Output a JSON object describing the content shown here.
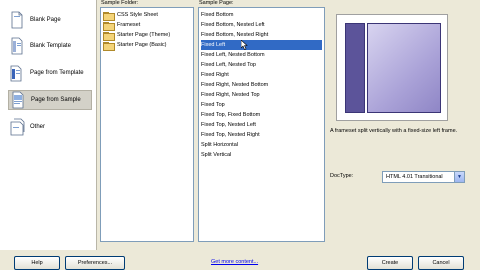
{
  "categories": [
    {
      "label": "Blank Page",
      "icon": "blank-page-icon",
      "selected": false
    },
    {
      "label": "Blank Template",
      "icon": "blank-template-icon",
      "selected": false
    },
    {
      "label": "Page from Template",
      "icon": "page-from-template-icon",
      "selected": false
    },
    {
      "label": "Page from Sample",
      "icon": "page-from-sample-icon",
      "selected": true
    },
    {
      "label": "Other",
      "icon": "other-icon",
      "selected": false
    }
  ],
  "sample_folder": {
    "label": "Sample Folder:",
    "items": [
      "CSS Style Sheet",
      "Frameset",
      "Starter Page (Theme)",
      "Starter Page (Basic)"
    ],
    "selected_index": 1
  },
  "sample_page": {
    "label": "Sample Page:",
    "items": [
      "Fixed Bottom",
      "Fixed Bottom, Nested Left",
      "Fixed Bottom, Nested Right",
      "Fixed Left",
      "Fixed Left, Nested Bottom",
      "Fixed Left, Nested Top",
      "Fixed Right",
      "Fixed Right, Nested Bottom",
      "Fixed Right, Nested Top",
      "Fixed Top",
      "Fixed Top, Fixed Bottom",
      "Fixed Top, Nested Left",
      "Fixed Top, Nested Right",
      "Split Horizontal",
      "Split Vertical"
    ],
    "selected_index": 3
  },
  "preview": {
    "description": "A frameset split vertically with a fixed-size left frame."
  },
  "doctype": {
    "label": "DocType:",
    "value": "HTML 4.01 Transitional"
  },
  "footer": {
    "help": "Help",
    "preferences": "Preferences...",
    "get_more": "Get more content...",
    "create": "Create",
    "cancel": "Cancel"
  },
  "colors": {
    "selection": "#316ac5",
    "dialog_bg": "#ece9d8",
    "frame_dark": "#5c549a",
    "frame_light": "#aba3d8"
  }
}
